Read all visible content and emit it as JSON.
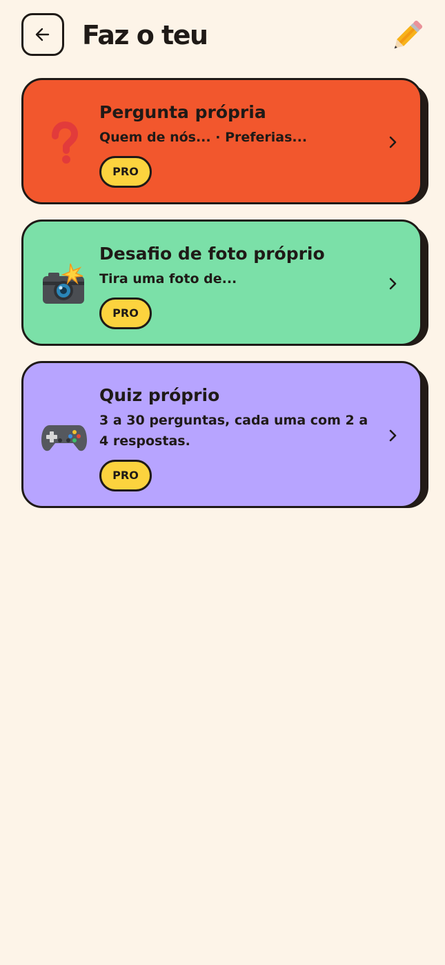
{
  "header": {
    "title": "Faz o teu",
    "back_icon": "arrow-left-icon",
    "corner_icon": "pencil-icon"
  },
  "cards": [
    {
      "title": "Pergunta própria",
      "subtitle": "Quem de nós... · Preferias...",
      "badge": "PRO",
      "icon": "question-mark-icon",
      "color": "#f2572d"
    },
    {
      "title": "Desafio de foto próprio",
      "subtitle": "Tira uma foto de...",
      "badge": "PRO",
      "icon": "camera-flash-icon",
      "color": "#7be0a8"
    },
    {
      "title": "Quiz próprio",
      "subtitle": "3 a 30 perguntas, cada uma com 2 a 4 respostas.",
      "badge": "PRO",
      "icon": "game-controller-icon",
      "color": "#b7a4ff"
    }
  ],
  "colors": {
    "background": "#fdf4e8",
    "ink": "#1f1a17",
    "badge": "#fcd33e"
  }
}
